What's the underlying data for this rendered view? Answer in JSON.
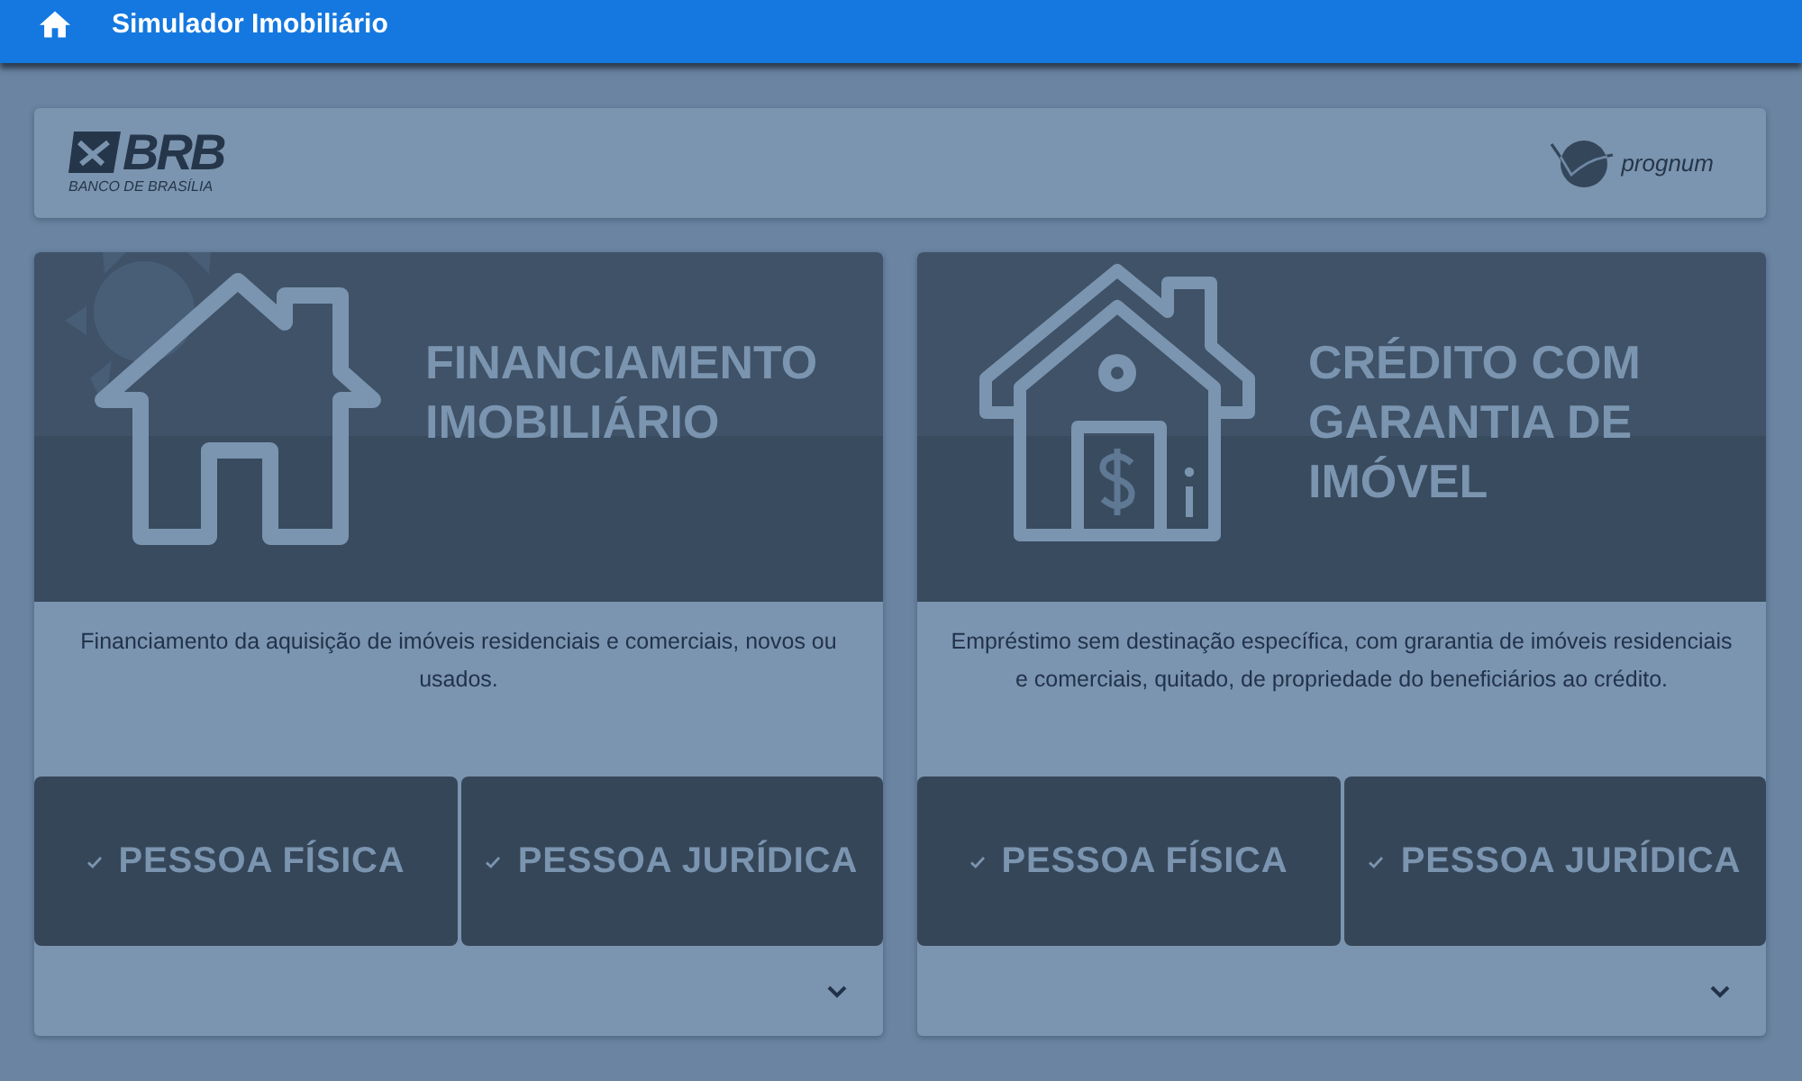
{
  "app_bar": {
    "title": "Simulador Imobiliário"
  },
  "header": {
    "bank_logo": {
      "wordmark": "BRB",
      "tagline": "BANCO DE BRASÍLIA"
    },
    "partner_logo": {
      "wordmark": "prognum"
    }
  },
  "products": [
    {
      "kind": "house",
      "title": "FINANCIAMENTO IMOBILIÁRIO",
      "description": "Financiamento da aquisição de imóveis residenciais e comerciais, novos ou usados.",
      "options": [
        "PESSOA FÍSICA",
        "PESSOA JURÍDICA"
      ]
    },
    {
      "kind": "house_money",
      "title": "CRÉDITO COM GARANTIA DE IMÓVEL",
      "description": "Empréstimo sem destinação específica, com grarantia de imóveis residenciais e comerciais, quitado, de propriedade do beneficiários ao crédito.",
      "options": [
        "PESSOA FÍSICA",
        "PESSOA JURÍDICA"
      ]
    }
  ]
}
